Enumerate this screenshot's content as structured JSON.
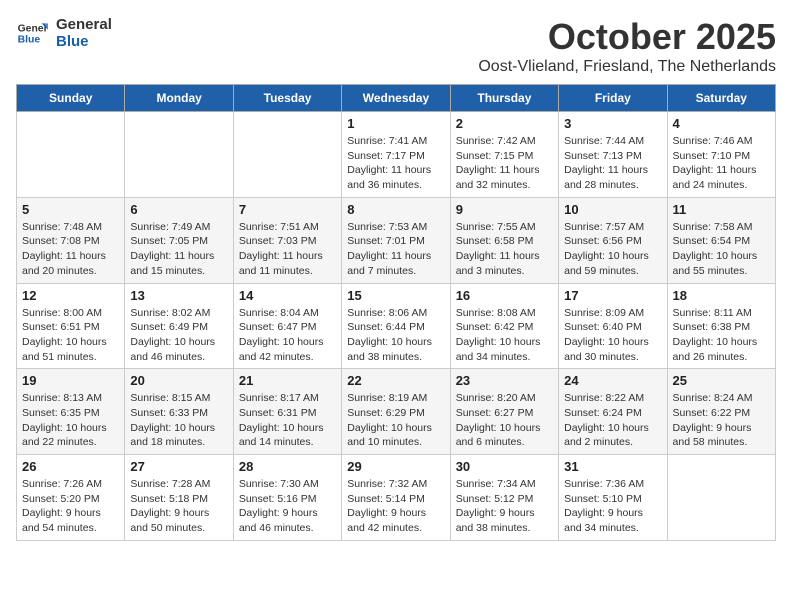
{
  "logo": {
    "line1": "General",
    "line2": "Blue"
  },
  "title": "October 2025",
  "location": "Oost-Vlieland, Friesland, The Netherlands",
  "days_of_week": [
    "Sunday",
    "Monday",
    "Tuesday",
    "Wednesday",
    "Thursday",
    "Friday",
    "Saturday"
  ],
  "weeks": [
    [
      {
        "day": "",
        "info": ""
      },
      {
        "day": "",
        "info": ""
      },
      {
        "day": "",
        "info": ""
      },
      {
        "day": "1",
        "info": "Sunrise: 7:41 AM\nSunset: 7:17 PM\nDaylight: 11 hours\nand 36 minutes."
      },
      {
        "day": "2",
        "info": "Sunrise: 7:42 AM\nSunset: 7:15 PM\nDaylight: 11 hours\nand 32 minutes."
      },
      {
        "day": "3",
        "info": "Sunrise: 7:44 AM\nSunset: 7:13 PM\nDaylight: 11 hours\nand 28 minutes."
      },
      {
        "day": "4",
        "info": "Sunrise: 7:46 AM\nSunset: 7:10 PM\nDaylight: 11 hours\nand 24 minutes."
      }
    ],
    [
      {
        "day": "5",
        "info": "Sunrise: 7:48 AM\nSunset: 7:08 PM\nDaylight: 11 hours\nand 20 minutes."
      },
      {
        "day": "6",
        "info": "Sunrise: 7:49 AM\nSunset: 7:05 PM\nDaylight: 11 hours\nand 15 minutes."
      },
      {
        "day": "7",
        "info": "Sunrise: 7:51 AM\nSunset: 7:03 PM\nDaylight: 11 hours\nand 11 minutes."
      },
      {
        "day": "8",
        "info": "Sunrise: 7:53 AM\nSunset: 7:01 PM\nDaylight: 11 hours\nand 7 minutes."
      },
      {
        "day": "9",
        "info": "Sunrise: 7:55 AM\nSunset: 6:58 PM\nDaylight: 11 hours\nand 3 minutes."
      },
      {
        "day": "10",
        "info": "Sunrise: 7:57 AM\nSunset: 6:56 PM\nDaylight: 10 hours\nand 59 minutes."
      },
      {
        "day": "11",
        "info": "Sunrise: 7:58 AM\nSunset: 6:54 PM\nDaylight: 10 hours\nand 55 minutes."
      }
    ],
    [
      {
        "day": "12",
        "info": "Sunrise: 8:00 AM\nSunset: 6:51 PM\nDaylight: 10 hours\nand 51 minutes."
      },
      {
        "day": "13",
        "info": "Sunrise: 8:02 AM\nSunset: 6:49 PM\nDaylight: 10 hours\nand 46 minutes."
      },
      {
        "day": "14",
        "info": "Sunrise: 8:04 AM\nSunset: 6:47 PM\nDaylight: 10 hours\nand 42 minutes."
      },
      {
        "day": "15",
        "info": "Sunrise: 8:06 AM\nSunset: 6:44 PM\nDaylight: 10 hours\nand 38 minutes."
      },
      {
        "day": "16",
        "info": "Sunrise: 8:08 AM\nSunset: 6:42 PM\nDaylight: 10 hours\nand 34 minutes."
      },
      {
        "day": "17",
        "info": "Sunrise: 8:09 AM\nSunset: 6:40 PM\nDaylight: 10 hours\nand 30 minutes."
      },
      {
        "day": "18",
        "info": "Sunrise: 8:11 AM\nSunset: 6:38 PM\nDaylight: 10 hours\nand 26 minutes."
      }
    ],
    [
      {
        "day": "19",
        "info": "Sunrise: 8:13 AM\nSunset: 6:35 PM\nDaylight: 10 hours\nand 22 minutes."
      },
      {
        "day": "20",
        "info": "Sunrise: 8:15 AM\nSunset: 6:33 PM\nDaylight: 10 hours\nand 18 minutes."
      },
      {
        "day": "21",
        "info": "Sunrise: 8:17 AM\nSunset: 6:31 PM\nDaylight: 10 hours\nand 14 minutes."
      },
      {
        "day": "22",
        "info": "Sunrise: 8:19 AM\nSunset: 6:29 PM\nDaylight: 10 hours\nand 10 minutes."
      },
      {
        "day": "23",
        "info": "Sunrise: 8:20 AM\nSunset: 6:27 PM\nDaylight: 10 hours\nand 6 minutes."
      },
      {
        "day": "24",
        "info": "Sunrise: 8:22 AM\nSunset: 6:24 PM\nDaylight: 10 hours\nand 2 minutes."
      },
      {
        "day": "25",
        "info": "Sunrise: 8:24 AM\nSunset: 6:22 PM\nDaylight: 9 hours\nand 58 minutes."
      }
    ],
    [
      {
        "day": "26",
        "info": "Sunrise: 7:26 AM\nSunset: 5:20 PM\nDaylight: 9 hours\nand 54 minutes."
      },
      {
        "day": "27",
        "info": "Sunrise: 7:28 AM\nSunset: 5:18 PM\nDaylight: 9 hours\nand 50 minutes."
      },
      {
        "day": "28",
        "info": "Sunrise: 7:30 AM\nSunset: 5:16 PM\nDaylight: 9 hours\nand 46 minutes."
      },
      {
        "day": "29",
        "info": "Sunrise: 7:32 AM\nSunset: 5:14 PM\nDaylight: 9 hours\nand 42 minutes."
      },
      {
        "day": "30",
        "info": "Sunrise: 7:34 AM\nSunset: 5:12 PM\nDaylight: 9 hours\nand 38 minutes."
      },
      {
        "day": "31",
        "info": "Sunrise: 7:36 AM\nSunset: 5:10 PM\nDaylight: 9 hours\nand 34 minutes."
      },
      {
        "day": "",
        "info": ""
      }
    ]
  ]
}
